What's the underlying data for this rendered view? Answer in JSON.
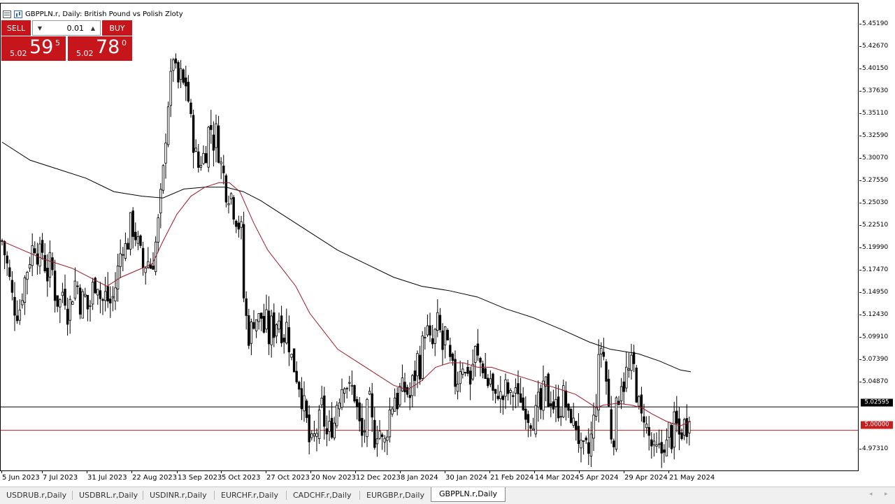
{
  "window": {
    "title": "GBPPLN.r, Daily:  British Pound vs Polish Zloty"
  },
  "trade_panel": {
    "sell_label": "SELL",
    "buy_label": "BUY",
    "lot_value": "0.01",
    "sell_price_prefix": "5.02",
    "sell_price_big": "59",
    "sell_price_sup": "5",
    "buy_price_prefix": "5.02",
    "buy_price_big": "78",
    "buy_price_sup": "0"
  },
  "colors": {
    "trade_red": "#c6151b",
    "ma_fast": "#a01828",
    "ma_slow": "#000000",
    "level_line": "#c81e1e"
  },
  "price_axis": {
    "labels": [
      "5.45190",
      "5.42670",
      "5.40150",
      "5.37630",
      "5.35110",
      "5.32590",
      "5.30070",
      "5.27550",
      "5.25030",
      "5.22510",
      "5.19990",
      "5.17470",
      "5.14950",
      "5.12430",
      "5.09910",
      "5.07390",
      "5.04870",
      "4.97310"
    ],
    "current_price_tag": "5.02595",
    "level_tag": "5.00000"
  },
  "time_axis": {
    "labels": [
      "5 Jun 2023",
      "7 Jul 2023",
      "31 Jul 2023",
      "22 Aug 2023",
      "13 Sep 2023",
      "5 Oct 2023",
      "27 Oct 2023",
      "20 Nov 2023",
      "12 Dec 2023",
      "8 Jan 2024",
      "30 Jan 2024",
      "21 Feb 2024",
      "14 Mar 2024",
      "5 Apr 2024",
      "29 Apr 2024",
      "21 May 2024"
    ]
  },
  "chart_data": {
    "type": "candlestick",
    "symbol": "GBPPLN.r",
    "timeframe": "Daily",
    "y_range": [
      4.957,
      5.474
    ],
    "current_price": 5.02595,
    "horizontal_level": 5.0,
    "close_path": [
      [
        0,
        5.21
      ],
      [
        8,
        5.18
      ],
      [
        16,
        5.14
      ],
      [
        24,
        5.13
      ],
      [
        30,
        5.16
      ],
      [
        36,
        5.18
      ],
      [
        42,
        5.2
      ],
      [
        48,
        5.21
      ],
      [
        52,
        5.19
      ],
      [
        58,
        5.2
      ],
      [
        64,
        5.17
      ],
      [
        70,
        5.19
      ],
      [
        76,
        5.15
      ],
      [
        82,
        5.14
      ],
      [
        88,
        5.16
      ],
      [
        94,
        5.13
      ],
      [
        100,
        5.15
      ],
      [
        106,
        5.17
      ],
      [
        112,
        5.14
      ],
      [
        118,
        5.15
      ],
      [
        124,
        5.13
      ],
      [
        130,
        5.16
      ],
      [
        136,
        5.17
      ],
      [
        142,
        5.14
      ],
      [
        148,
        5.15
      ],
      [
        154,
        5.14
      ],
      [
        160,
        5.15
      ],
      [
        166,
        5.18
      ],
      [
        172,
        5.21
      ],
      [
        178,
        5.2
      ],
      [
        184,
        5.23
      ],
      [
        190,
        5.22
      ],
      [
        196,
        5.2
      ],
      [
        202,
        5.18
      ],
      [
        208,
        5.19
      ],
      [
        214,
        5.18
      ],
      [
        218,
        5.2
      ],
      [
        222,
        5.22
      ],
      [
        226,
        5.25
      ],
      [
        230,
        5.28
      ],
      [
        234,
        5.33
      ],
      [
        238,
        5.37
      ],
      [
        242,
        5.39
      ],
      [
        246,
        5.43
      ],
      [
        250,
        5.37
      ],
      [
        254,
        5.4
      ],
      [
        258,
        5.38
      ],
      [
        262,
        5.39
      ],
      [
        266,
        5.37
      ],
      [
        270,
        5.34
      ],
      [
        274,
        5.32
      ],
      [
        278,
        5.3
      ],
      [
        282,
        5.29
      ],
      [
        286,
        5.31
      ],
      [
        290,
        5.3
      ],
      [
        294,
        5.33
      ],
      [
        298,
        5.34
      ],
      [
        302,
        5.32
      ],
      [
        306,
        5.33
      ],
      [
        310,
        5.31
      ],
      [
        314,
        5.29
      ],
      [
        318,
        5.28
      ],
      [
        322,
        5.26
      ],
      [
        326,
        5.27
      ],
      [
        330,
        5.25
      ],
      [
        334,
        5.24
      ],
      [
        338,
        5.23
      ],
      [
        342,
        5.22
      ],
      [
        346,
        5.14
      ],
      [
        350,
        5.12
      ],
      [
        354,
        5.1
      ],
      [
        358,
        5.12
      ],
      [
        362,
        5.13
      ],
      [
        366,
        5.12
      ],
      [
        370,
        5.13
      ],
      [
        374,
        5.11
      ],
      [
        378,
        5.12
      ],
      [
        382,
        5.1
      ],
      [
        386,
        5.12
      ],
      [
        390,
        5.11
      ],
      [
        394,
        5.13
      ],
      [
        398,
        5.12
      ],
      [
        402,
        5.1
      ],
      [
        406,
        5.12
      ],
      [
        410,
        5.1
      ],
      [
        414,
        5.08
      ],
      [
        418,
        5.07
      ],
      [
        422,
        5.06
      ],
      [
        426,
        5.05
      ],
      [
        430,
        5.03
      ],
      [
        434,
        5.02
      ],
      [
        438,
        4.99
      ],
      [
        442,
        4.98
      ],
      [
        446,
        4.99
      ],
      [
        450,
        5.0
      ],
      [
        454,
        5.01
      ],
      [
        458,
        5.03
      ],
      [
        462,
        5.0
      ],
      [
        466,
        4.99
      ],
      [
        470,
        5.01
      ],
      [
        474,
        5.0
      ],
      [
        478,
        5.03
      ],
      [
        482,
        5.04
      ],
      [
        486,
        5.05
      ],
      [
        490,
        5.06
      ],
      [
        494,
        5.05
      ],
      [
        498,
        5.04
      ],
      [
        502,
        5.05
      ],
      [
        506,
        5.03
      ],
      [
        510,
        5.01
      ],
      [
        514,
        4.99
      ],
      [
        518,
        5.0
      ],
      [
        522,
        5.02
      ],
      [
        526,
        5.03
      ],
      [
        530,
        5.0
      ],
      [
        534,
        4.99
      ],
      [
        538,
        5.01
      ],
      [
        542,
        4.99
      ],
      [
        546,
        4.98
      ],
      [
        550,
        5.0
      ],
      [
        554,
        5.02
      ],
      [
        558,
        5.03
      ],
      [
        562,
        5.04
      ],
      [
        566,
        5.03
      ],
      [
        570,
        5.05
      ],
      [
        574,
        5.04
      ],
      [
        578,
        5.05
      ],
      [
        582,
        5.03
      ],
      [
        586,
        5.05
      ],
      [
        590,
        5.06
      ],
      [
        594,
        5.08
      ],
      [
        598,
        5.07
      ],
      [
        602,
        5.1
      ],
      [
        606,
        5.12
      ],
      [
        610,
        5.1
      ],
      [
        614,
        5.09
      ],
      [
        618,
        5.1
      ],
      [
        622,
        5.12
      ],
      [
        626,
        5.11
      ],
      [
        630,
        5.09
      ],
      [
        634,
        5.11
      ],
      [
        638,
        5.08
      ],
      [
        642,
        5.07
      ],
      [
        646,
        5.06
      ],
      [
        650,
        5.05
      ],
      [
        654,
        5.07
      ],
      [
        658,
        5.08
      ],
      [
        662,
        5.06
      ],
      [
        666,
        5.07
      ],
      [
        670,
        5.05
      ],
      [
        674,
        5.08
      ],
      [
        678,
        5.09
      ],
      [
        682,
        5.07
      ],
      [
        686,
        5.08
      ],
      [
        690,
        5.06
      ],
      [
        694,
        5.05
      ],
      [
        698,
        5.06
      ],
      [
        702,
        5.04
      ],
      [
        706,
        5.03
      ],
      [
        710,
        5.05
      ],
      [
        714,
        5.03
      ],
      [
        718,
        5.04
      ],
      [
        722,
        5.05
      ],
      [
        726,
        5.03
      ],
      [
        730,
        5.04
      ],
      [
        734,
        5.05
      ],
      [
        738,
        5.03
      ],
      [
        742,
        5.04
      ],
      [
        746,
        5.02
      ],
      [
        750,
        5.03
      ],
      [
        754,
        5.01
      ],
      [
        758,
        5.02
      ],
      [
        762,
        5.01
      ],
      [
        766,
        5.03
      ],
      [
        770,
        5.02
      ],
      [
        774,
        5.04
      ],
      [
        778,
        5.05
      ],
      [
        782,
        5.03
      ],
      [
        786,
        5.04
      ],
      [
        790,
        5.02
      ],
      [
        794,
        5.03
      ],
      [
        798,
        5.02
      ],
      [
        802,
        5.04
      ],
      [
        806,
        5.03
      ],
      [
        810,
        5.01
      ],
      [
        814,
        5.02
      ],
      [
        818,
        5.0
      ],
      [
        822,
        5.01
      ],
      [
        826,
        4.98
      ],
      [
        830,
        4.97
      ],
      [
        834,
        4.98
      ],
      [
        838,
        4.97
      ],
      [
        842,
        4.99
      ],
      [
        846,
        5.01
      ],
      [
        850,
        5.04
      ],
      [
        854,
        5.08
      ],
      [
        858,
        5.1
      ],
      [
        862,
        5.07
      ],
      [
        866,
        5.04
      ],
      [
        870,
        5.0
      ],
      [
        874,
        4.99
      ],
      [
        878,
        5.02
      ],
      [
        882,
        5.04
      ],
      [
        886,
        5.06
      ],
      [
        890,
        5.05
      ],
      [
        894,
        5.07
      ],
      [
        898,
        5.06
      ],
      [
        902,
        5.08
      ],
      [
        906,
        5.05
      ],
      [
        910,
        5.03
      ],
      [
        914,
        5.01
      ],
      [
        918,
        5.02
      ],
      [
        922,
        5.0
      ],
      [
        926,
        4.99
      ],
      [
        930,
        4.98
      ],
      [
        934,
        4.97
      ],
      [
        938,
        4.98
      ],
      [
        942,
        4.97
      ],
      [
        946,
        4.99
      ],
      [
        950,
        4.98
      ],
      [
        954,
        5.0
      ],
      [
        958,
        4.99
      ],
      [
        962,
        5.01
      ],
      [
        966,
        5.0
      ],
      [
        970,
        4.99
      ],
      [
        974,
        5.01
      ],
      [
        978,
        5.0
      ],
      [
        982,
        5.02
      ],
      [
        986,
        5.04
      ]
    ],
    "ma_fast_path": [
      [
        0,
        5.21
      ],
      [
        30,
        5.2
      ],
      [
        60,
        5.19
      ],
      [
        100,
        5.18
      ],
      [
        150,
        5.16
      ],
      [
        170,
        5.17
      ],
      [
        200,
        5.18
      ],
      [
        215,
        5.185
      ],
      [
        230,
        5.21
      ],
      [
        250,
        5.24
      ],
      [
        270,
        5.26
      ],
      [
        290,
        5.27
      ],
      [
        310,
        5.275
      ],
      [
        325,
        5.275
      ],
      [
        340,
        5.265
      ],
      [
        360,
        5.23
      ],
      [
        380,
        5.2
      ],
      [
        400,
        5.18
      ],
      [
        420,
        5.16
      ],
      [
        440,
        5.13
      ],
      [
        460,
        5.11
      ],
      [
        480,
        5.09
      ],
      [
        500,
        5.08
      ],
      [
        520,
        5.07
      ],
      [
        540,
        5.06
      ],
      [
        560,
        5.05
      ],
      [
        580,
        5.045
      ],
      [
        600,
        5.055
      ],
      [
        620,
        5.07
      ],
      [
        640,
        5.075
      ],
      [
        660,
        5.075
      ],
      [
        680,
        5.07
      ],
      [
        700,
        5.07
      ],
      [
        720,
        5.065
      ],
      [
        740,
        5.06
      ],
      [
        760,
        5.055
      ],
      [
        780,
        5.05
      ],
      [
        800,
        5.045
      ],
      [
        820,
        5.04
      ],
      [
        840,
        5.03
      ],
      [
        850,
        5.025
      ],
      [
        860,
        5.028
      ],
      [
        880,
        5.03
      ],
      [
        900,
        5.028
      ],
      [
        915,
        5.025
      ],
      [
        930,
        5.018
      ],
      [
        950,
        5.01
      ],
      [
        970,
        5.005
      ],
      [
        985,
        5.01
      ]
    ],
    "ma_slow_path": [
      [
        0,
        5.32
      ],
      [
        40,
        5.3
      ],
      [
        80,
        5.29
      ],
      [
        120,
        5.28
      ],
      [
        160,
        5.265
      ],
      [
        200,
        5.26
      ],
      [
        230,
        5.258
      ],
      [
        260,
        5.268
      ],
      [
        290,
        5.27
      ],
      [
        320,
        5.27
      ],
      [
        345,
        5.265
      ],
      [
        370,
        5.255
      ],
      [
        400,
        5.24
      ],
      [
        440,
        5.22
      ],
      [
        480,
        5.2
      ],
      [
        520,
        5.185
      ],
      [
        560,
        5.17
      ],
      [
        600,
        5.16
      ],
      [
        640,
        5.155
      ],
      [
        680,
        5.148
      ],
      [
        720,
        5.135
      ],
      [
        760,
        5.125
      ],
      [
        800,
        5.112
      ],
      [
        840,
        5.098
      ],
      [
        870,
        5.09
      ],
      [
        910,
        5.085
      ],
      [
        940,
        5.077
      ],
      [
        970,
        5.067
      ],
      [
        985,
        5.065
      ]
    ]
  },
  "tabs": [
    {
      "label": "USDRUB.r,Daily",
      "active": false
    },
    {
      "label": "USDBRL.r,Daily",
      "active": false
    },
    {
      "label": "USDINR.r,Daily",
      "active": false
    },
    {
      "label": "EURCHF.r,Daily",
      "active": false
    },
    {
      "label": "CADCHF.r,Daily",
      "active": false
    },
    {
      "label": "EURGBP.r,Daily",
      "active": false
    },
    {
      "label": "GBPPLN.r,Daily",
      "active": true
    }
  ],
  "tab_scroll": {
    "left_icon": "chevron-left-icon",
    "right_icon": "chevron-right-icon",
    "left_glyph": "◂",
    "right_glyph": "▸"
  }
}
